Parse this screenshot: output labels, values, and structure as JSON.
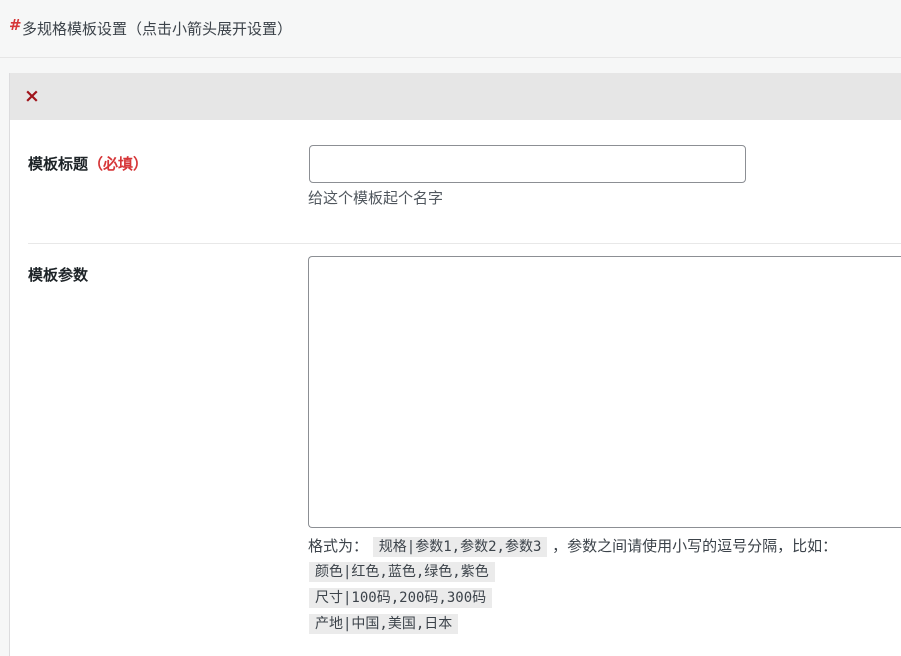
{
  "section": {
    "hash": "#",
    "title": "多规格模板设置（点击小箭头展开设置）"
  },
  "panel": {
    "close_icon": "×",
    "template_title": {
      "label": "模板标题",
      "required": "（必填）",
      "value": "",
      "placeholder": "",
      "description": "给这个模板起个名字"
    },
    "template_params": {
      "label": "模板参数",
      "value": "",
      "format_prefix": "格式为：",
      "format_code": "规格|参数1,参数2,参数3",
      "format_suffix": "，参数之间请使用小写的逗号分隔，比如：",
      "examples": [
        "颜色|红色,蓝色,绿色,紫色",
        "尺寸|100码,200码,300码",
        "产地|中国,美国,日本"
      ]
    }
  }
}
